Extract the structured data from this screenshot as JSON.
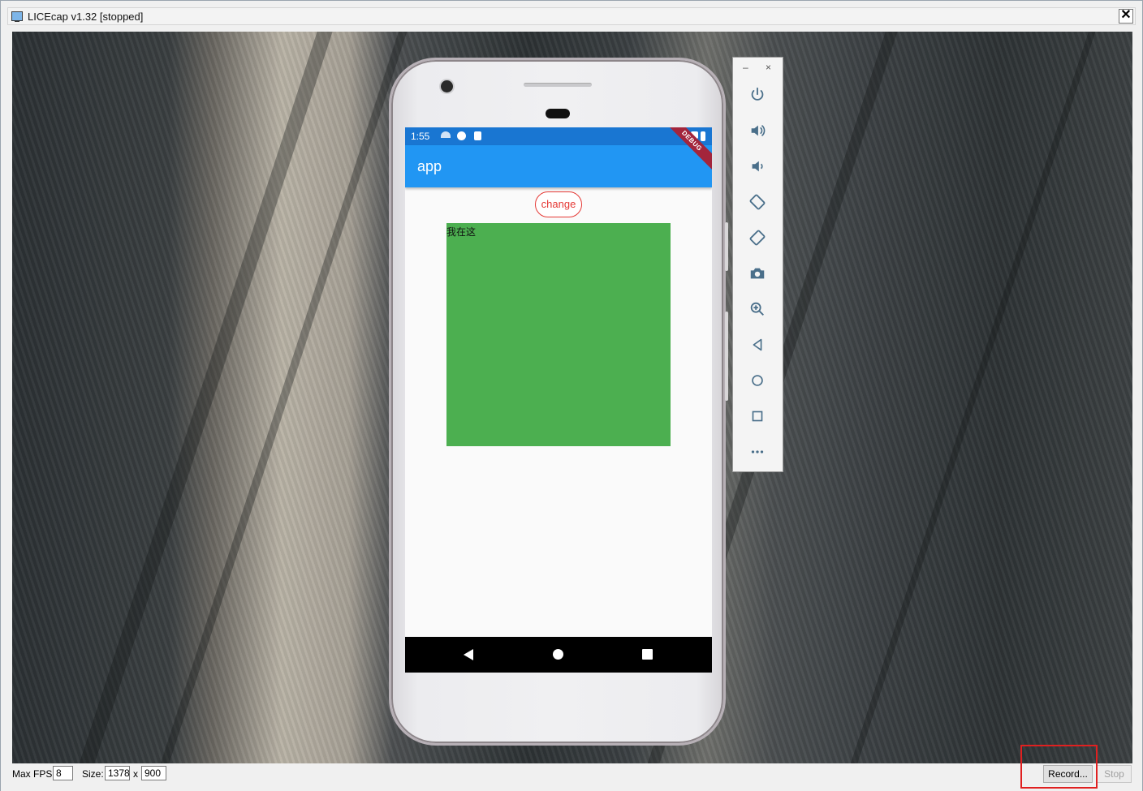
{
  "window": {
    "title": "LICEcap v1.32 [stopped]",
    "close_label": "✕"
  },
  "phone": {
    "status_time": "1:55",
    "app_title": "app",
    "debug_banner": "DEBUG",
    "change_button": "change",
    "box_text": "我在这",
    "box_color": "#4caf50",
    "appbar_color": "#2196f3"
  },
  "emulator_toolbar": {
    "minimize_label": "–",
    "close_label": "×",
    "buttons": [
      "power-icon",
      "volume-up-icon",
      "volume-down-icon",
      "rotate-left-icon",
      "rotate-right-icon",
      "camera-icon",
      "zoom-icon",
      "back-icon",
      "home-icon",
      "overview-icon",
      "more-icon"
    ]
  },
  "bottom_bar": {
    "max_fps_label": "Max FPS:",
    "max_fps_value": "8",
    "size_label": "Size:",
    "width_value": "1378",
    "x_label": "x",
    "height_value": "900",
    "record_button": "Record...",
    "stop_button": "Stop"
  },
  "accent": {
    "highlight_color": "#e02020"
  }
}
